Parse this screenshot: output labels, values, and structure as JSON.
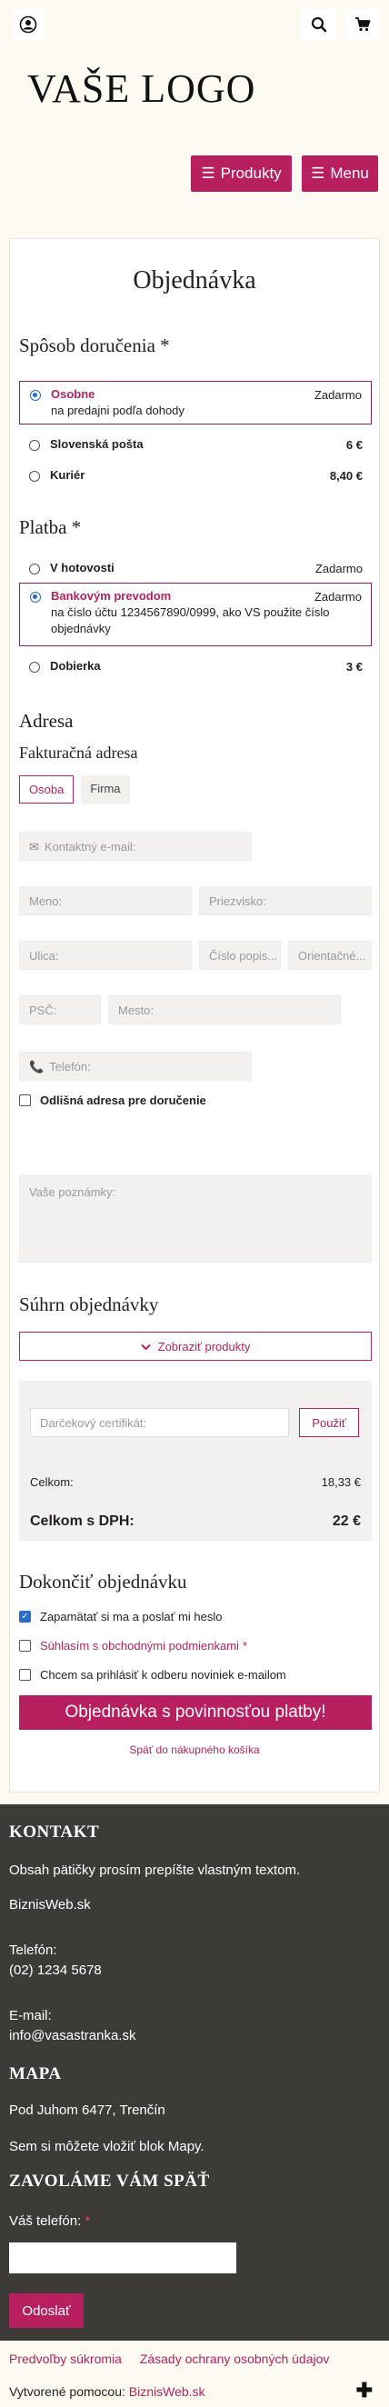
{
  "header": {
    "logo": "VAŠE LOGO",
    "nav": {
      "products": "Produkty",
      "menu": "Menu"
    },
    "icons": [
      "user-icon",
      "search-icon",
      "cart-icon"
    ]
  },
  "order": {
    "title": "Objednávka",
    "delivery": {
      "heading": "Spôsob doručenia *",
      "options": [
        {
          "name": "Osobne",
          "price": "Zadarmo",
          "desc": "na predajni podľa dohody",
          "selected": true
        },
        {
          "name": "Slovenská pošta",
          "price": "6 €",
          "selected": false
        },
        {
          "name": "Kuriér",
          "price": "8,40 €",
          "selected": false
        }
      ]
    },
    "payment": {
      "heading": "Platba *",
      "options": [
        {
          "name": "V hotovosti",
          "price": "Zadarmo",
          "selected": false
        },
        {
          "name": "Bankovým prevodom",
          "price": "Zadarmo",
          "desc": "na číslo účtu 1234567890/0999, ako VS použite číslo objednávky",
          "selected": true
        },
        {
          "name": "Dobierka",
          "price": "3 €",
          "selected": false
        }
      ]
    },
    "address": {
      "heading": "Adresa",
      "subheading": "Fakturačná adresa",
      "tabs": [
        "Osoba",
        "Firma"
      ],
      "email_placeholder": "Kontaktný e-mail:",
      "first_name_placeholder": "Meno:",
      "last_name_placeholder": "Priezvisko:",
      "street_placeholder": "Ulica:",
      "number_placeholder": "Číslo popis...",
      "orient_placeholder": "Orientačné...",
      "zip_placeholder": "PSČ:",
      "city_placeholder": "Mesto:",
      "phone_placeholder": "Telefón:",
      "different_address": "Odlišná adresa pre doručenie",
      "notes_placeholder": "Vaše poznámky:"
    },
    "summary": {
      "heading": "Súhrn objednávky",
      "show_products": "Zobraziť produkty",
      "voucher_placeholder": "Darčekový certifikát:",
      "apply": "Použiť",
      "total_label": "Celkom:",
      "total_value": "18,33 €",
      "total_vat_label": "Celkom s DPH:",
      "total_vat_value": "22 €"
    },
    "finish": {
      "heading": "Dokončiť objednávku",
      "remember": "Zapamätať si ma a poslať mi heslo",
      "agree": "Súhlasím s obchodnými podmienkami",
      "agree_required": "*",
      "newsletter": "Chcem sa prihlásiť k odberu noviniek e-mailom",
      "submit": "Objednávka s povinnosťou platby!",
      "back": "Späť do nákupného košíka"
    }
  },
  "footer": {
    "contact_heading": "KONTAKT",
    "contact_text": "Obsah pätičky prosím prepíšte vlastným textom.",
    "company": "BiznisWeb.sk",
    "phone_label": "Telefón:",
    "phone": "(02) 1234 5678",
    "email_label": "E-mail:",
    "email": "info@vasastranka.sk",
    "map_heading": "MAPA",
    "map_address": "Pod Juhom 6477, Trenčín",
    "map_text": "Sem si môžete vložiť blok Mapy.",
    "callback_heading": "ZAVOLÁME VÁM SPÄŤ",
    "callback_label": "Váš telefón:",
    "callback_required": "*",
    "send": "Odoslať",
    "links": [
      "Predvoľby súkromia",
      "Zásady ochrany osobných údajov"
    ],
    "made_by_label": "Vytvorené pomocou:",
    "made_by": "BiznisWeb.sk"
  },
  "colors": {
    "accent": "#b81f5e",
    "footer_bg": "#3d3b38",
    "page_bg": "#fdfaf2"
  }
}
